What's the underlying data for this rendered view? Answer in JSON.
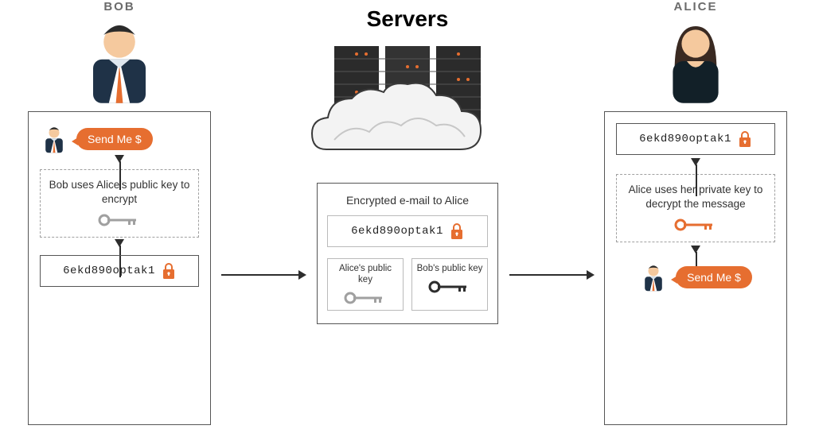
{
  "labels": {
    "bob": "BOB",
    "alice": "ALICE",
    "servers": "Servers"
  },
  "bubble_text": "Send Me $",
  "cipher": "6ekd890optak1",
  "bob_step": "Bob uses Alice's public key to encrypt",
  "alice_step": "Alice uses her private key to decrypt the message",
  "server_caption": "Encrypted e-mail to Alice",
  "alice_key_label": "Alice's public key",
  "bob_key_label": "Bob's public key",
  "colors": {
    "orange": "#e66e30",
    "navy": "#1f3247",
    "grey": "#a0a0a0",
    "dark": "#2d2d2d"
  },
  "icon_names": {
    "lock": "lock-icon",
    "key": "key-icon",
    "avatar_man": "man-avatar-icon",
    "avatar_woman": "woman-avatar-icon",
    "server_rack": "server-rack-icon",
    "cloud": "cloud-icon"
  }
}
